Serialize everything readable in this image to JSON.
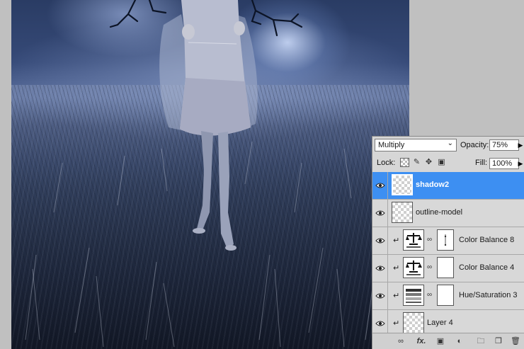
{
  "layers_panel": {
    "blend_mode": "Multiply",
    "opacity_label": "Opacity:",
    "opacity_value": "75%",
    "lock_label": "Lock:",
    "fill_label": "Fill:",
    "fill_value": "100%",
    "accent_color": "#3d8ff2",
    "layers": [
      {
        "name": "shadow2",
        "type": "pixel",
        "selected": true,
        "visible": true,
        "clipped": false
      },
      {
        "name": "outline-model",
        "type": "pixel",
        "selected": false,
        "visible": true,
        "clipped": false
      },
      {
        "name": "Color Balance 8",
        "type": "color-balance",
        "selected": false,
        "visible": true,
        "clipped": true
      },
      {
        "name": "Color Balance 4",
        "type": "color-balance",
        "selected": false,
        "visible": true,
        "clipped": true
      },
      {
        "name": "Hue/Saturation 3",
        "type": "hue-saturation",
        "selected": false,
        "visible": true,
        "clipped": true
      },
      {
        "name": "Layer 4",
        "type": "pixel",
        "selected": false,
        "visible": true,
        "clipped": true
      }
    ],
    "footer_icons": [
      "link-layers-icon",
      "fx-icon",
      "add-mask-icon",
      "adjustment-layer-icon",
      "new-group-icon",
      "new-layer-icon",
      "delete-layer-icon"
    ],
    "footer_fx_text": "fx."
  }
}
